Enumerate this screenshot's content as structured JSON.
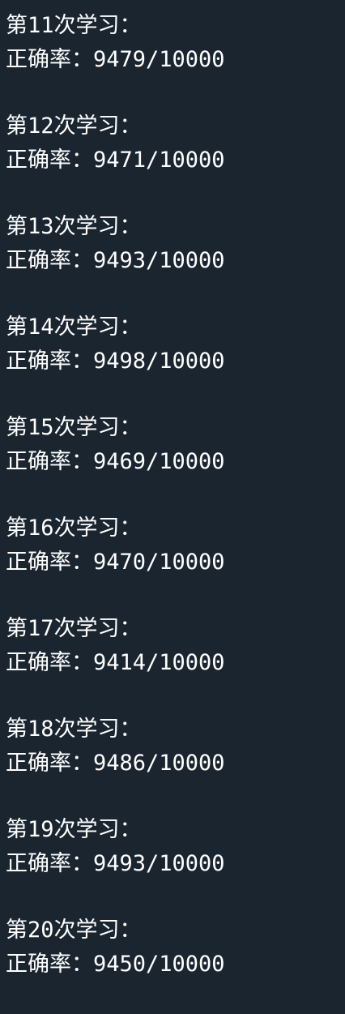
{
  "terminal": {
    "background": "#1b2530",
    "text_color": "#ffffff",
    "lines": [
      {
        "epoch": "第11次学习：",
        "accuracy": "正确率：9479/10000"
      },
      {
        "epoch": "第12次学习：",
        "accuracy": "正确率：9471/10000"
      },
      {
        "epoch": "第13次学习：",
        "accuracy": "正确率：9493/10000"
      },
      {
        "epoch": "第14次学习：",
        "accuracy": "正确率：9498/10000"
      },
      {
        "epoch": "第15次学习：",
        "accuracy": "正确率：9469/10000"
      },
      {
        "epoch": "第16次学习：",
        "accuracy": "正确率：9470/10000"
      },
      {
        "epoch": "第17次学习：",
        "accuracy": "正确率：9414/10000"
      },
      {
        "epoch": "第18次学习：",
        "accuracy": "正确率：9486/10000"
      },
      {
        "epoch": "第19次学习：",
        "accuracy": "正确率：9493/10000"
      },
      {
        "epoch": "第20次学习：",
        "accuracy": "正确率：9450/10000"
      }
    ]
  }
}
